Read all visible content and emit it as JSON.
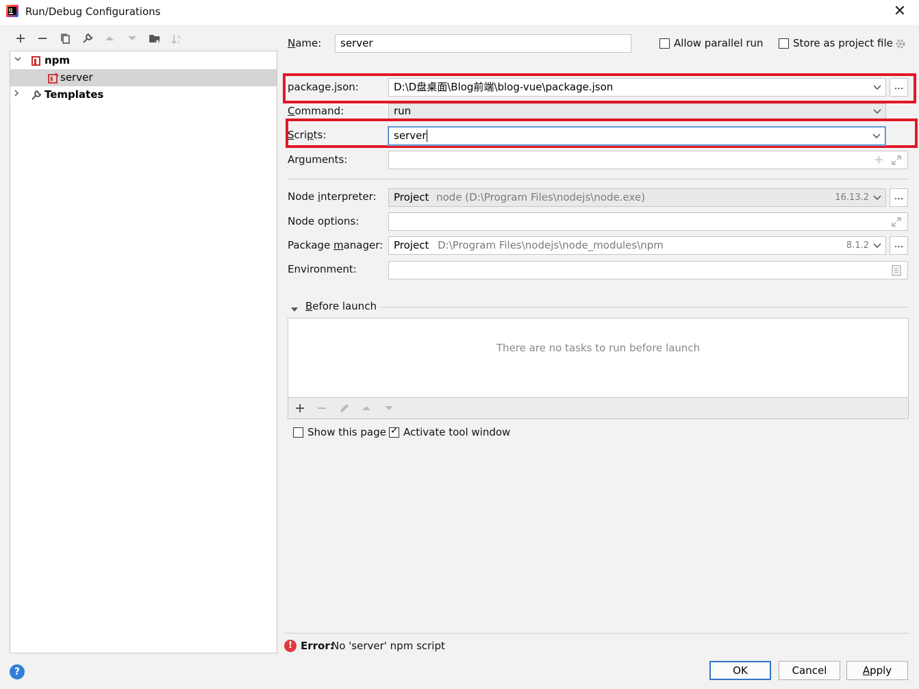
{
  "window": {
    "title": "Run/Debug Configurations"
  },
  "toolbar": {
    "add": "+",
    "remove": "−",
    "copy": "⧉",
    "edit": "🔧",
    "up": "▲",
    "down": "▼",
    "folder": "📁",
    "sort": "⇅"
  },
  "tree": {
    "npm_label": "npm",
    "server_label": "server",
    "templates_label": "Templates"
  },
  "form": {
    "name_label": "Name:",
    "name_value": "server",
    "allow_parallel_label": "Allow parallel run",
    "store_project_label": "Store as project file",
    "package_json_label": "package.json:",
    "package_json_value": "D:\\D盘桌面\\Blog前端\\blog-vue\\package.json",
    "command_label": "Command:",
    "command_value": "run",
    "scripts_label": "Scripts:",
    "scripts_value": "server",
    "arguments_label": "Arguments:",
    "node_interpreter_label": "Node interpreter:",
    "node_interpreter_prefix": "Project",
    "node_interpreter_value": "node (D:\\Program Files\\nodejs\\node.exe)",
    "node_version": "16.13.2",
    "node_options_label": "Node options:",
    "package_manager_label": "Package manager:",
    "package_manager_prefix": "Project",
    "package_manager_value": "D:\\Program Files\\nodejs\\node_modules\\npm",
    "package_manager_version": "8.1.2",
    "environment_label": "Environment:",
    "before_launch_label": "Before launch",
    "no_tasks_text": "There are no tasks to run before launch",
    "show_page_label": "Show this page",
    "activate_tool_label": "Activate tool window"
  },
  "error": {
    "prefix": "Error:",
    "message": "No 'server' npm script"
  },
  "buttons": {
    "ok": "OK",
    "cancel": "Cancel",
    "apply": "Apply",
    "more": "...",
    "help": "?"
  },
  "colors": {
    "highlight_red": "#e11726",
    "focus_blue": "#2f74c8",
    "npm_red": "#cb2c2c"
  }
}
